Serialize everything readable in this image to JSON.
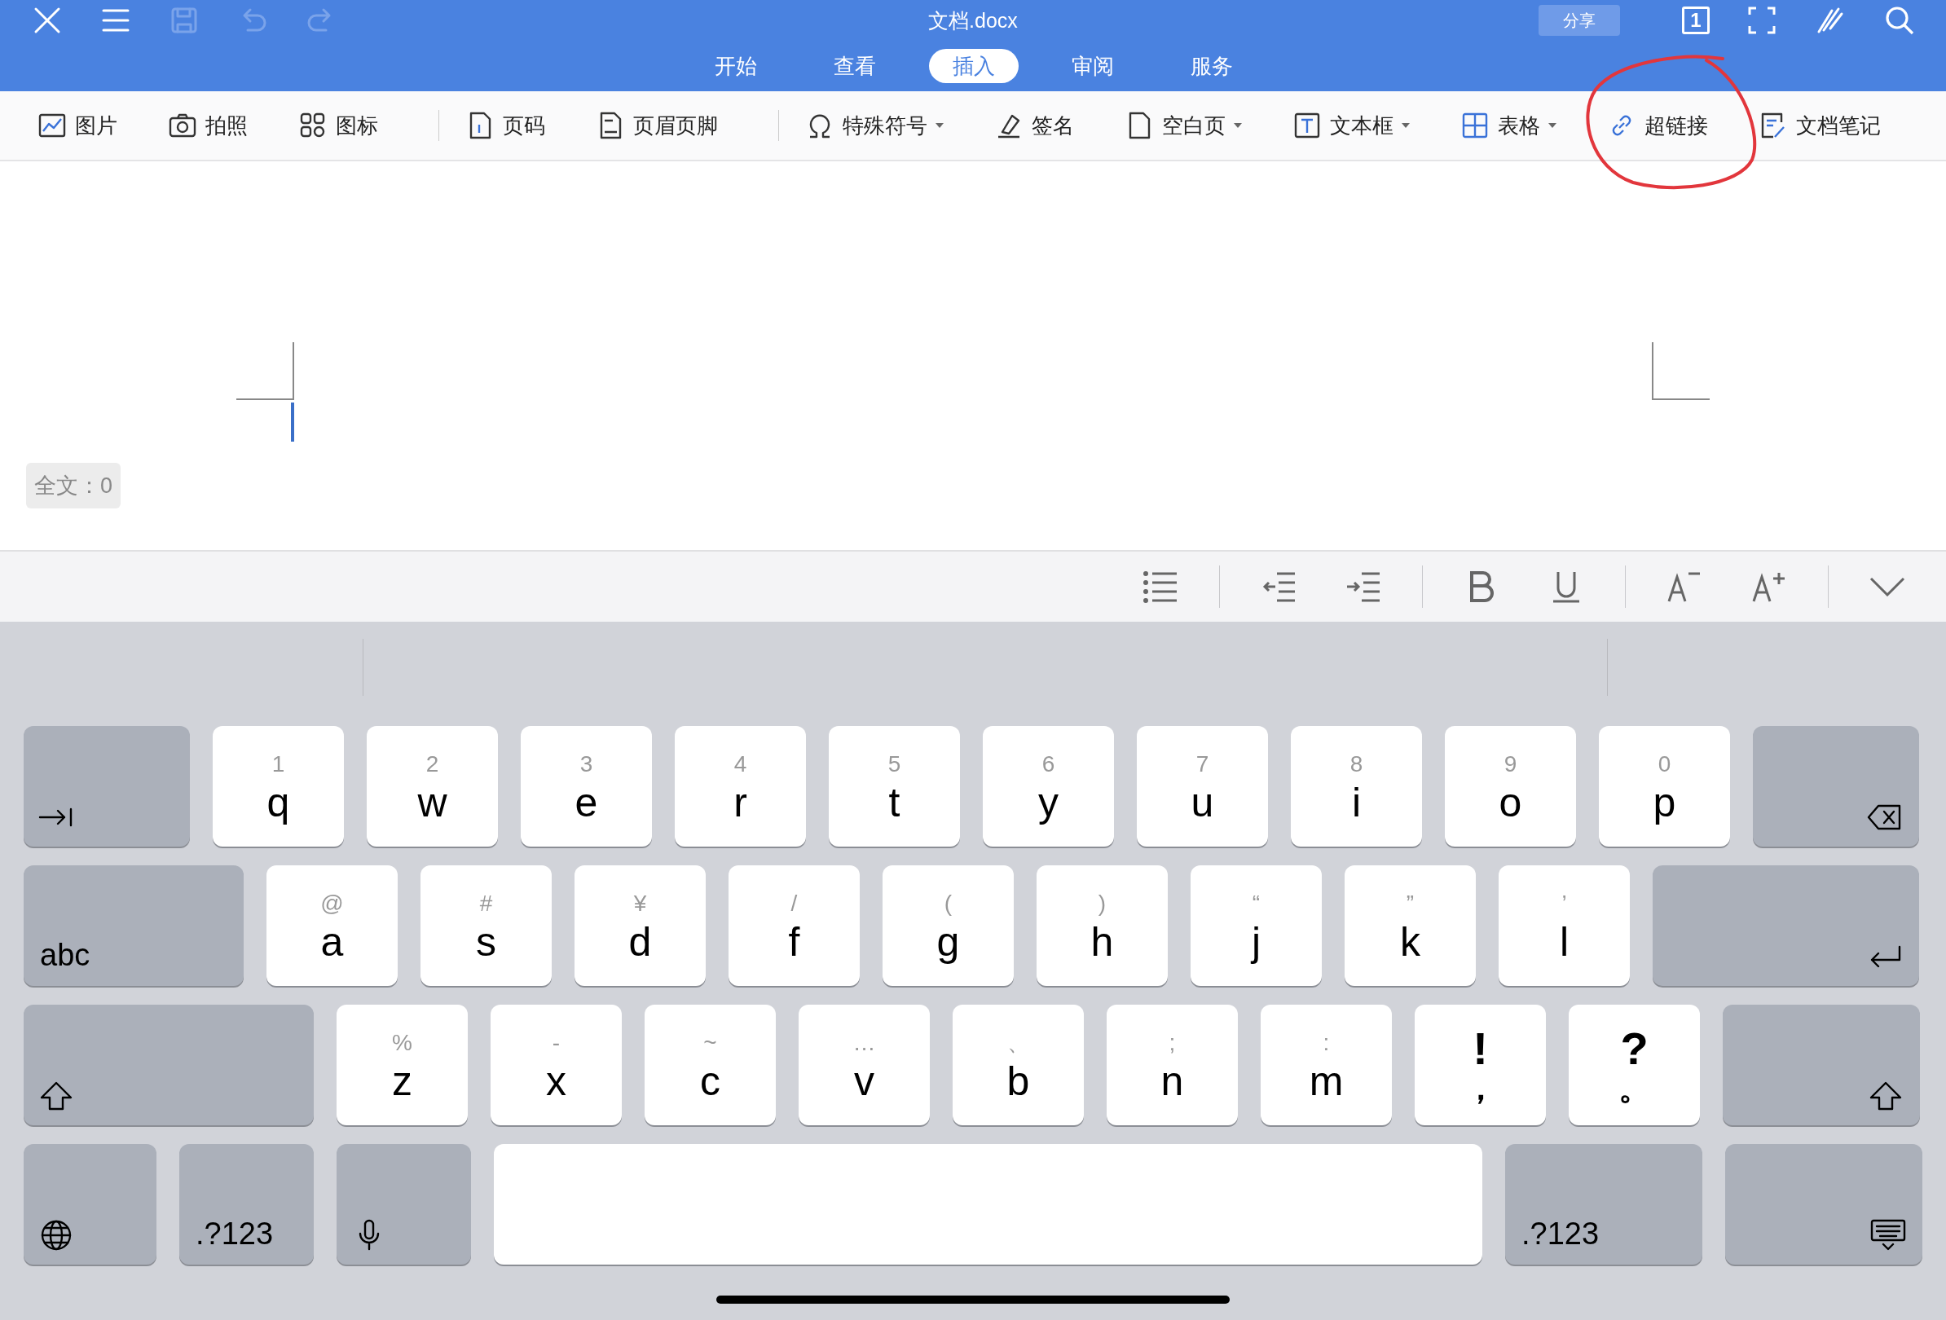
{
  "window": {
    "title": "文档.docx",
    "share_button": "分享",
    "page_indicator": "1"
  },
  "left_tools": [
    {
      "disabled": false
    },
    {
      "disabled": false
    },
    {
      "disabled": true
    },
    {
      "disabled": true
    },
    {
      "disabled": true
    }
  ],
  "tabs": [
    {
      "label": "开始",
      "selected": false
    },
    {
      "label": "查看",
      "selected": false
    },
    {
      "label": "插入",
      "selected": true
    },
    {
      "label": "审阅",
      "selected": false
    },
    {
      "label": "服务",
      "selected": false
    }
  ],
  "toolbar": {
    "groups": [
      {
        "items": [
          {
            "label": "图片",
            "dropdown": false
          },
          {
            "label": "拍照",
            "dropdown": false
          },
          {
            "label": "图标",
            "dropdown": false
          }
        ]
      },
      {
        "items": [
          {
            "label": "页码",
            "dropdown": false
          },
          {
            "label": "页眉页脚",
            "dropdown": false
          }
        ]
      },
      {
        "items": [
          {
            "label": "特殊符号",
            "dropdown": true
          },
          {
            "label": "签名",
            "dropdown": false
          },
          {
            "label": "空白页",
            "dropdown": true
          },
          {
            "label": "文本框",
            "dropdown": true
          },
          {
            "label": "表格",
            "dropdown": true
          },
          {
            "label": "超链接",
            "dropdown": false,
            "circled": true
          },
          {
            "label": "文档笔记",
            "dropdown": false
          }
        ]
      }
    ]
  },
  "document": {
    "word_count": "全文：0"
  },
  "keyboard": {
    "rows": [
      [
        {
          "kind": "tab"
        },
        {
          "kind": "letter",
          "main": "q",
          "alt": "1"
        },
        {
          "kind": "letter",
          "main": "w",
          "alt": "2"
        },
        {
          "kind": "letter",
          "main": "e",
          "alt": "3"
        },
        {
          "kind": "letter",
          "main": "r",
          "alt": "4"
        },
        {
          "kind": "letter",
          "main": "t",
          "alt": "5"
        },
        {
          "kind": "letter",
          "main": "y",
          "alt": "6"
        },
        {
          "kind": "letter",
          "main": "u",
          "alt": "7"
        },
        {
          "kind": "letter",
          "main": "i",
          "alt": "8"
        },
        {
          "kind": "letter",
          "main": "o",
          "alt": "9"
        },
        {
          "kind": "letter",
          "main": "p",
          "alt": "0"
        },
        {
          "kind": "delete"
        }
      ],
      [
        {
          "kind": "label",
          "main": "abc"
        },
        {
          "kind": "letter",
          "main": "a",
          "alt": "@"
        },
        {
          "kind": "letter",
          "main": "s",
          "alt": "#"
        },
        {
          "kind": "letter",
          "main": "d",
          "alt": "¥"
        },
        {
          "kind": "letter",
          "main": "f",
          "alt": "/"
        },
        {
          "kind": "letter",
          "main": "g",
          "alt": "("
        },
        {
          "kind": "letter",
          "main": "h",
          "alt": ")"
        },
        {
          "kind": "letter",
          "main": "j",
          "alt": "“"
        },
        {
          "kind": "letter",
          "main": "k",
          "alt": "”"
        },
        {
          "kind": "letter",
          "main": "l",
          "alt": "’"
        },
        {
          "kind": "return"
        }
      ],
      [
        {
          "kind": "shift"
        },
        {
          "kind": "letter",
          "main": "z",
          "alt": "%"
        },
        {
          "kind": "letter",
          "main": "x",
          "alt": "-"
        },
        {
          "kind": "letter",
          "main": "c",
          "alt": "~"
        },
        {
          "kind": "letter",
          "main": "v",
          "alt": "…"
        },
        {
          "kind": "letter",
          "main": "b",
          "alt": "、"
        },
        {
          "kind": "letter",
          "main": "n",
          "alt": ";"
        },
        {
          "kind": "letter",
          "main": "m",
          "alt": ":"
        },
        {
          "kind": "punct",
          "main": "，",
          "alt": "!"
        },
        {
          "kind": "punct",
          "main": "。",
          "alt": "?"
        },
        {
          "kind": "shift"
        }
      ],
      [
        {
          "kind": "globe"
        },
        {
          "kind": "label",
          "main": ".?123"
        },
        {
          "kind": "mic"
        },
        {
          "kind": "space"
        },
        {
          "kind": "label",
          "main": ".?123"
        },
        {
          "kind": "hide"
        }
      ]
    ]
  }
}
